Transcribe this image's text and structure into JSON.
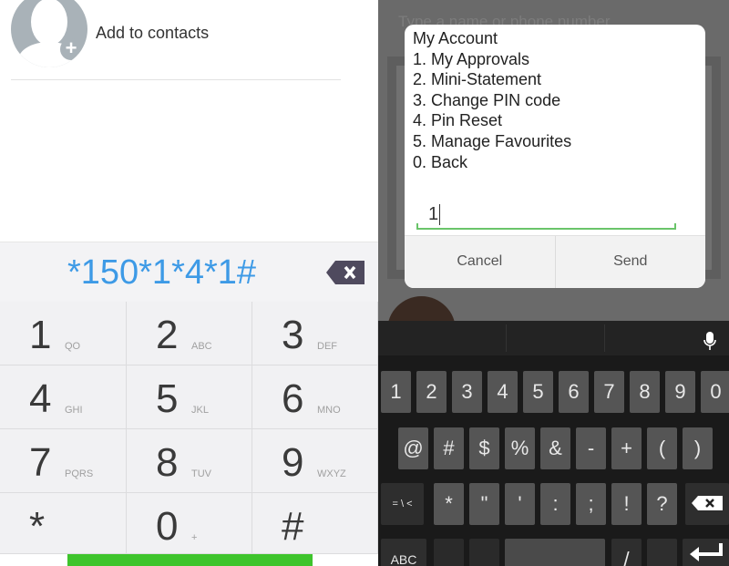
{
  "dialer": {
    "add_contacts": "Add to contacts",
    "number": "*150*1*4*1#",
    "keys": [
      {
        "d": "1",
        "l": "QO"
      },
      {
        "d": "2",
        "l": "ABC"
      },
      {
        "d": "3",
        "l": "DEF"
      },
      {
        "d": "4",
        "l": "GHI"
      },
      {
        "d": "5",
        "l": "JKL"
      },
      {
        "d": "6",
        "l": "MNO"
      },
      {
        "d": "7",
        "l": "PQRS"
      },
      {
        "d": "8",
        "l": "TUV"
      },
      {
        "d": "9",
        "l": "WXYZ"
      },
      {
        "d": "*",
        "l": ""
      },
      {
        "d": "0",
        "l": "+"
      },
      {
        "d": "#",
        "l": ""
      }
    ],
    "call_color": "#3ec42c",
    "number_color": "#3d9ae6"
  },
  "background": {
    "search_placeholder": "Type a name or phone number"
  },
  "ussd": {
    "message": "My Account\n1. My Approvals\n2. Mini-Statement\n3. Change PIN code\n4. Pin Reset\n5. Manage Favourites\n0. Back",
    "input_value": "1",
    "cancel": "Cancel",
    "send": "Send"
  },
  "keyboard": {
    "row1": [
      "1",
      "2",
      "3",
      "4",
      "5",
      "6",
      "7",
      "8",
      "9",
      "0"
    ],
    "row2": [
      "@",
      "#",
      "$",
      "%",
      "&",
      "-",
      "+",
      "(",
      ")"
    ],
    "row3": [
      "= \\ <",
      "*",
      "\"",
      "'",
      ":",
      ";",
      "!",
      "?"
    ],
    "row4": [
      "ABC",
      "",
      "",
      "",
      "/",
      ""
    ]
  }
}
